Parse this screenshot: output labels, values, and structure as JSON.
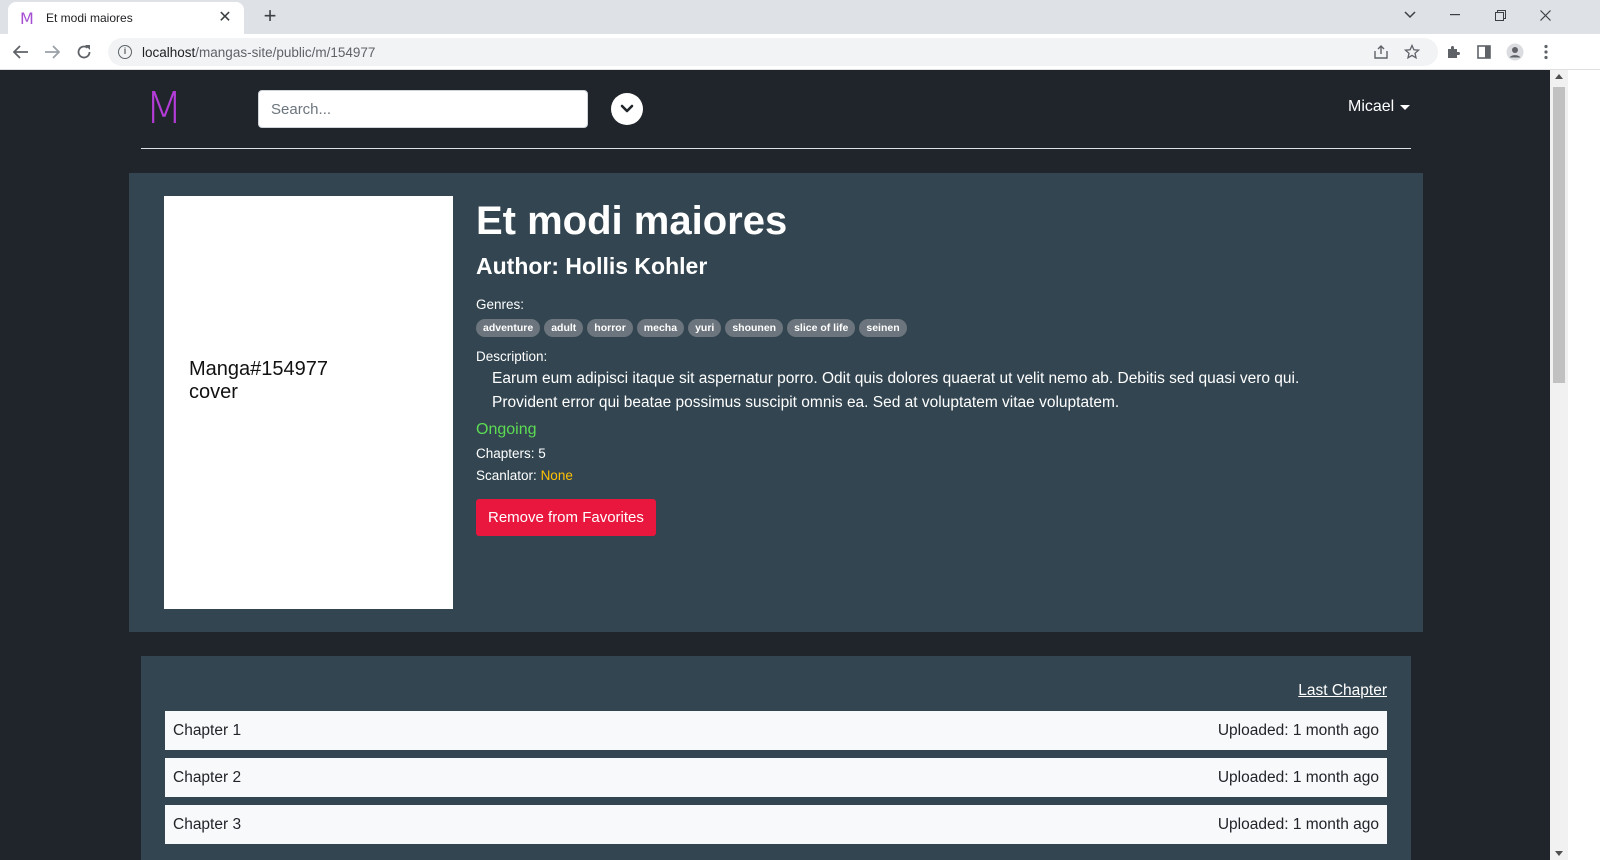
{
  "browser": {
    "tab_title": "Et modi maiores",
    "tab_favicon": "M",
    "url_host": "localhost",
    "url_path": "/mangas-site/public/m/154977"
  },
  "header": {
    "logo": "M",
    "search_placeholder": "Search...",
    "user_name": "Micael"
  },
  "manga": {
    "cover_text_line1": "Manga#154977",
    "cover_text_line2": "cover",
    "title": "Et modi maiores",
    "author": "Author: Hollis Kohler",
    "genres_label": "Genres:",
    "genres": [
      "adventure",
      "adult",
      "horror",
      "mecha",
      "yuri",
      "shounen",
      "slice of life",
      "seinen"
    ],
    "description_label": "Description:",
    "description_line1": "Earum eum adipisci itaque sit aspernatur porro. Odit quis dolores quaerat ut velit nemo ab. Debitis sed quasi vero qui.",
    "description_line2": "Provident error qui beatae possimus suscipit omnis ea. Sed at voluptatem vitae voluptatem.",
    "status": "Ongoing",
    "chapters_label": "Chapters: 5",
    "scanlator_label": "Scanlator:",
    "scanlator_value": "None",
    "favorite_button": "Remove from Favorites"
  },
  "chapters": {
    "last_chapter_link": "Last Chapter",
    "items": [
      {
        "name": "Chapter 1",
        "uploaded": "Uploaded: 1 month ago"
      },
      {
        "name": "Chapter 2",
        "uploaded": "Uploaded: 1 month ago"
      },
      {
        "name": "Chapter 3",
        "uploaded": "Uploaded: 1 month ago"
      }
    ]
  },
  "colors": {
    "logo": "#b33cd8",
    "page_bg": "#1f252b",
    "card_bg": "#324550",
    "status_ongoing": "#5ddc53",
    "scanlator_none": "#ffc107",
    "favorite_button": "#e9163d",
    "badge": "#6c757d"
  }
}
